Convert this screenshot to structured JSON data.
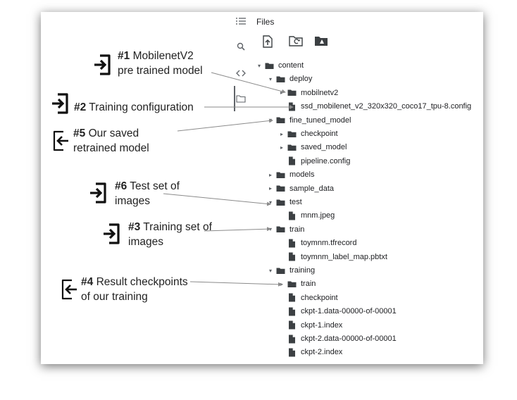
{
  "files_panel": {
    "title": "Files",
    "rail_icons": [
      "menu-icon",
      "search-icon",
      "code-icon",
      "folder-icon"
    ],
    "toolbar_icons": [
      "upload-icon",
      "refresh-folder-icon",
      "drive-folder-icon"
    ]
  },
  "tree": [
    {
      "label": "content",
      "type": "folder",
      "depth": 0,
      "caret": "down"
    },
    {
      "label": "deploy",
      "type": "folder",
      "depth": 1,
      "caret": "down"
    },
    {
      "label": "mobilnetv2",
      "type": "folder",
      "depth": 2,
      "caret": "right"
    },
    {
      "label": "ssd_mobilenet_v2_320x320_coco17_tpu-8.config",
      "type": "file",
      "depth": 2,
      "caret": "none"
    },
    {
      "label": "fine_tuned_model",
      "type": "folder",
      "depth": 1,
      "caret": "down"
    },
    {
      "label": "checkpoint",
      "type": "folder",
      "depth": 2,
      "caret": "right"
    },
    {
      "label": "saved_model",
      "type": "folder",
      "depth": 2,
      "caret": "right"
    },
    {
      "label": "pipeline.config",
      "type": "file",
      "depth": 2,
      "caret": "none"
    },
    {
      "label": "models",
      "type": "folder",
      "depth": 1,
      "caret": "right"
    },
    {
      "label": "sample_data",
      "type": "folder",
      "depth": 1,
      "caret": "right"
    },
    {
      "label": "test",
      "type": "folder",
      "depth": 1,
      "caret": "down"
    },
    {
      "label": "mnm.jpeg",
      "type": "file",
      "depth": 2,
      "caret": "none"
    },
    {
      "label": "train",
      "type": "folder",
      "depth": 1,
      "caret": "down"
    },
    {
      "label": "toymnm.tfrecord",
      "type": "file",
      "depth": 2,
      "caret": "none"
    },
    {
      "label": "toymnm_label_map.pbtxt",
      "type": "file",
      "depth": 2,
      "caret": "none"
    },
    {
      "label": "training",
      "type": "folder",
      "depth": 1,
      "caret": "down"
    },
    {
      "label": "train",
      "type": "folder",
      "depth": 2,
      "caret": "right"
    },
    {
      "label": "checkpoint",
      "type": "file",
      "depth": 2,
      "caret": "none"
    },
    {
      "label": "ckpt-1.data-00000-of-00001",
      "type": "file",
      "depth": 2,
      "caret": "none"
    },
    {
      "label": "ckpt-1.index",
      "type": "file",
      "depth": 2,
      "caret": "none"
    },
    {
      "label": "ckpt-2.data-00000-of-00001",
      "type": "file",
      "depth": 2,
      "caret": "none"
    },
    {
      "label": "ckpt-2.index",
      "type": "file",
      "depth": 2,
      "caret": "none"
    }
  ],
  "annotations": [
    {
      "num": "#1",
      "text": "MobilenetV2",
      "line2": "pre trained model",
      "icon": "sign-in-icon"
    },
    {
      "num": "#2",
      "text": "Training configuration",
      "line2": "",
      "icon": "sign-in-icon"
    },
    {
      "num": "#5",
      "text": "Our saved",
      "line2": "retrained model",
      "icon": "sign-out-icon"
    },
    {
      "num": "#6",
      "text": "Test set of",
      "line2": "images",
      "icon": "sign-in-icon"
    },
    {
      "num": "#3",
      "text": "Training set of",
      "line2": "images",
      "icon": "sign-in-icon"
    },
    {
      "num": "#4",
      "text": "Result checkpoints",
      "line2": "of our training",
      "icon": "sign-out-icon"
    }
  ],
  "colors": {
    "folder": "#3c4043",
    "caret": "#5f6368",
    "arrow": "#8a8a8a",
    "annotation_text": "#222222"
  }
}
